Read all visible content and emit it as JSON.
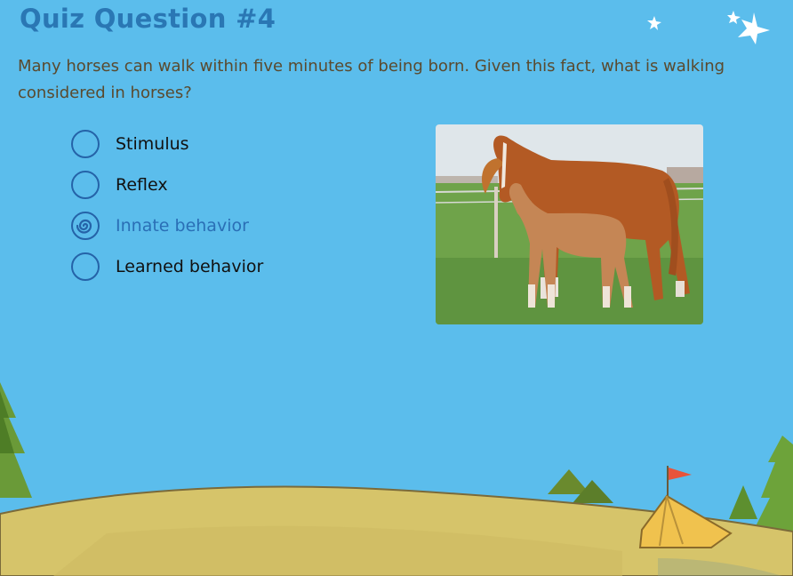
{
  "quiz": {
    "title": "Quiz Question #4",
    "question": "Many horses can walk within five minutes of being born. Given this fact, what is walking considered in horses?",
    "options": [
      {
        "label": "Stimulus",
        "selected": false
      },
      {
        "label": "Reflex",
        "selected": false
      },
      {
        "label": "Innate behavior",
        "selected": true
      },
      {
        "label": "Learned behavior",
        "selected": false
      }
    ]
  },
  "image": {
    "subject": "mare-and-foal-photo"
  },
  "colors": {
    "background": "#5bbdec",
    "title": "#2a77b4",
    "radio_border": "#2563a8",
    "selected_text": "#2a6fb6",
    "hill": "#d6c46a",
    "tree": "#5c8a2e"
  }
}
